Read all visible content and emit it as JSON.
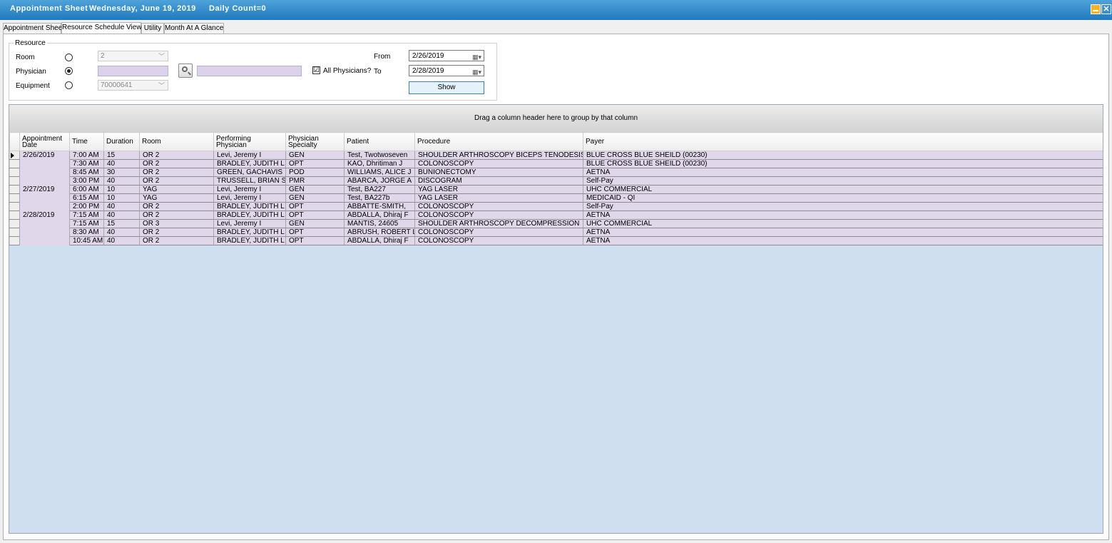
{
  "window": {
    "app_title": "Appointment Sheet",
    "date_label": "Wednesday, June 19, 2019",
    "count_label": "Daily Count=0",
    "minimize_icon": "minimize-icon",
    "close_icon": "close-icon",
    "close_glyph": "✕"
  },
  "tabs": [
    {
      "label": "Appointment Sheet"
    },
    {
      "label": "Resource Schedule View"
    },
    {
      "label": "Utility"
    },
    {
      "label": "Month At A Glance"
    }
  ],
  "resource": {
    "legend": "Resource",
    "room_label": "Room",
    "room_value": "2",
    "physician_label": "Physician",
    "equipment_label": "Equipment",
    "equipment_value": "70000641",
    "all_physicians_label": "All Physicians?",
    "all_physicians_checked": true,
    "all_physicians_checkmark": "☑",
    "selected_resource": "Physician",
    "lookup_icon": "magnifier-icon"
  },
  "dates": {
    "from_label": "From",
    "from_value": "2/26/2019",
    "to_label": "To",
    "to_value": "2/28/2019",
    "calendar_icon": "calendar-dropdown-icon",
    "calendar_glyph": "▦▾"
  },
  "show_button": "Show",
  "grid": {
    "group_hint": "Drag a column header here to group by that column",
    "columns": [
      "Appointment Date",
      "Time",
      "Duration",
      "Room",
      "Performing Physician",
      "Physician Specialty",
      "Patient",
      "Procedure",
      "Payer"
    ],
    "groups": [
      {
        "date": "2/26/2019",
        "rows": [
          {
            "time": "7:00 AM",
            "duration": "15",
            "room": "OR 2",
            "physician": "Levi, Jeremy I",
            "specialty": "GEN",
            "patient": "Test, Twotwoseven",
            "procedure": "SHOULDER ARTHROSCOPY BICEPS TENODESIS",
            "payer": "BLUE CROSS BLUE SHEILD (00230)"
          },
          {
            "time": "7:30 AM",
            "duration": "40",
            "room": "OR 2",
            "physician": "BRADLEY, JUDITH L",
            "specialty": "OPT",
            "patient": "KAO, Dhritiman J",
            "procedure": "COLONOSCOPY",
            "payer": "BLUE CROSS BLUE SHEILD (00230)"
          },
          {
            "time": "8:45 AM",
            "duration": "30",
            "room": "OR 2",
            "physician": "GREEN, GACHAVIS",
            "specialty": "POD",
            "patient": "WILLIAMS, ALICE J",
            "procedure": "BUNIONECTOMY",
            "payer": "AETNA"
          },
          {
            "time": "3:00 PM",
            "duration": "40",
            "room": "OR 2",
            "physician": "TRUSSELL, BRIAN S",
            "specialty": "PMR",
            "patient": "ABARCA, JORGE A",
            "procedure": "DISCOGRAM",
            "payer": "Self-Pay"
          }
        ]
      },
      {
        "date": "2/27/2019",
        "rows": [
          {
            "time": "6:00 AM",
            "duration": "10",
            "room": "YAG",
            "physician": "Levi, Jeremy I",
            "specialty": "GEN",
            "patient": "Test, BA227",
            "procedure": "YAG LASER",
            "payer": "UHC COMMERCIAL"
          },
          {
            "time": "6:15 AM",
            "duration": "10",
            "room": "YAG",
            "physician": "Levi, Jeremy I",
            "specialty": "GEN",
            "patient": "Test, BA227b",
            "procedure": "YAG LASER",
            "payer": "MEDICAID - QI"
          },
          {
            "time": "2:00 PM",
            "duration": "40",
            "room": "OR 2",
            "physician": "BRADLEY, JUDITH L",
            "specialty": "OPT",
            "patient": "ABBATTE-SMITH,",
            "procedure": "COLONOSCOPY",
            "payer": "Self-Pay"
          }
        ]
      },
      {
        "date": "2/28/2019",
        "rows": [
          {
            "time": "7:15 AM",
            "duration": "40",
            "room": "OR 2",
            "physician": "BRADLEY, JUDITH L",
            "specialty": "OPT",
            "patient": "ABDALLA, Dhiraj F",
            "procedure": "COLONOSCOPY",
            "payer": "AETNA"
          },
          {
            "time": "7:15 AM",
            "duration": "15",
            "room": "OR 3",
            "physician": "Levi, Jeremy I",
            "specialty": "GEN",
            "patient": "MANTIS, 24605",
            "procedure": "SHOULDER ARTHROSCOPY DECOMPRESSION",
            "payer": "UHC COMMERCIAL"
          },
          {
            "time": "8:30 AM",
            "duration": "40",
            "room": "OR 2",
            "physician": "BRADLEY, JUDITH L",
            "specialty": "OPT",
            "patient": "ABRUSH, ROBERT L",
            "procedure": "COLONOSCOPY",
            "payer": "AETNA"
          },
          {
            "time": "10:45 AM",
            "duration": "40",
            "room": "OR 2",
            "physician": "BRADLEY, JUDITH L",
            "specialty": "OPT",
            "patient": "ABDALLA, Dhiraj F",
            "procedure": "COLONOSCOPY",
            "payer": "AETNA"
          }
        ]
      }
    ],
    "current_row_icon": "row-indicator-arrow-icon"
  },
  "colors": {
    "titlebar": "#2a86c9",
    "row_background": "#e0d7ea",
    "grid_background": "#cfdff0",
    "input_highlight": "#dcd2ea"
  }
}
